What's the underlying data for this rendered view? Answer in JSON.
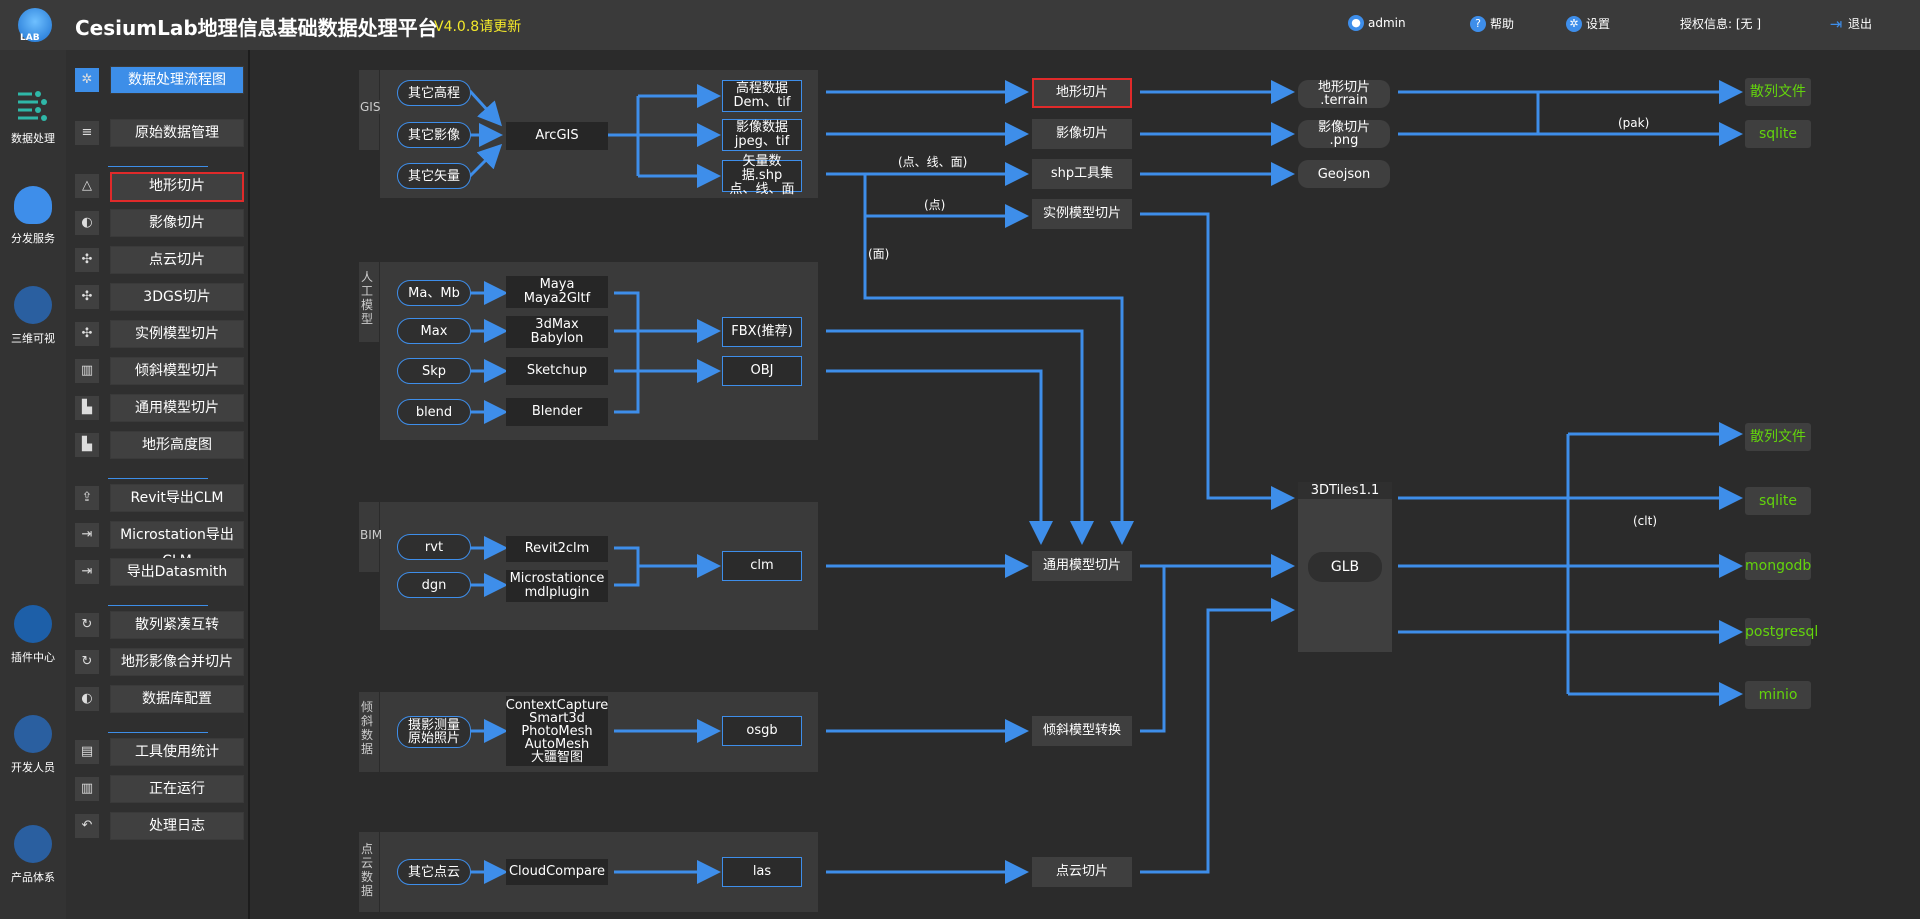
{
  "header": {
    "logo_text": "LAB",
    "title": "CesiumLab地理信息基础数据处理平台",
    "version": "V4.0.8请更新",
    "user": "admin",
    "help": "帮助",
    "settings": "设置",
    "license": "授权信息: [无 ]",
    "logout": "退出"
  },
  "leftnav": [
    "数据处理",
    "分发服务",
    "三维可视",
    "插件中心",
    "开发人员",
    "产品体系"
  ],
  "menu": {
    "items": [
      "数据处理流程图",
      "原始数据管理",
      "地形切片",
      "影像切片",
      "点云切片",
      "3DGS切片",
      "实例模型切片",
      "倾斜模型切片",
      "通用模型切片",
      "地形高度图",
      "Revit导出CLM",
      "Microstation导出CLM",
      "导出Datasmith",
      "散列紧凑互转",
      "地形影像合并切片",
      "数据库配置",
      "工具使用统计",
      "正在运行",
      "处理日志"
    ]
  },
  "flow": {
    "groups": {
      "gis": "GIS",
      "manual": "人工模型",
      "bim": "BIM",
      "oblique": "倾斜数据",
      "pointcloud": "点云数据"
    },
    "gis": {
      "inputs": [
        "其它高程",
        "其它影像",
        "其它矢量"
      ],
      "tool": "ArcGIS",
      "outputs": [
        [
          "高程数据",
          "Dem、tif"
        ],
        [
          "影像数据",
          "jpeg、tif"
        ],
        [
          "矢量数据.shp",
          "点、线、面"
        ]
      ]
    },
    "manual": {
      "inputs": [
        "Ma、Mb",
        "Max",
        "Skp",
        "blend"
      ],
      "tools": [
        [
          "Maya",
          "Maya2Gltf"
        ],
        [
          "3dMax",
          "Babylon"
        ],
        [
          "Sketchup"
        ],
        [
          "Blender"
        ]
      ],
      "outputs": [
        "FBX(推荐)",
        "OBJ"
      ]
    },
    "bim": {
      "inputs": [
        "rvt",
        "dgn"
      ],
      "tools": [
        [
          "Revit2clm"
        ],
        [
          "Microstationce",
          "mdlplugin"
        ]
      ],
      "output": "clm"
    },
    "oblique": {
      "input": [
        "摄影测量",
        "原始照片"
      ],
      "tool": [
        "ContextCapture",
        "Smart3d",
        "PhotoMesh",
        "AutoMesh",
        "大疆智图"
      ],
      "output": "osgb"
    },
    "pointcloud": {
      "input": "其它点云",
      "tool": "CloudCompare",
      "output": "las"
    },
    "processes": {
      "terrain": "地形切片",
      "imagery": "影像切片",
      "shp": "shp工具集",
      "instance": "实例模型切片",
      "general": "通用模型切片",
      "oblique": "倾斜模型转换",
      "pointcloud": "点云切片"
    },
    "results": {
      "terrain": [
        "地形切片",
        ".terrain"
      ],
      "imagery": [
        "影像切片",
        ".png"
      ],
      "geojson": "Geojson",
      "tiles_head": "3DTiles1.1",
      "glb": "GLB"
    },
    "edge_labels": {
      "plm": "(点、线、面)",
      "point": "(点)",
      "face": "(面)",
      "pak": "(pak)",
      "clt": "(clt)"
    },
    "stores_top": [
      "散列文件",
      "sqlite"
    ],
    "stores_bottom": [
      "散列文件",
      "sqlite",
      "mongodb",
      "postgresql",
      "minio"
    ]
  }
}
